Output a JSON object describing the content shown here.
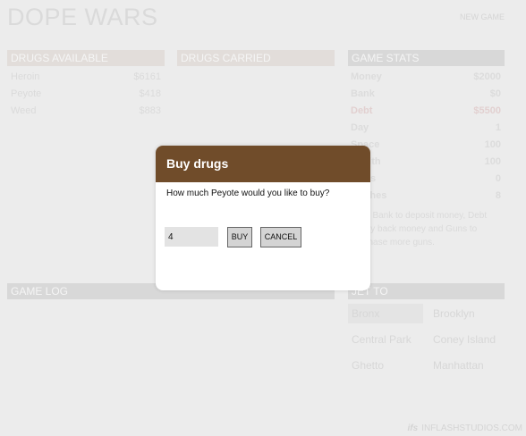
{
  "header": {
    "title": "DOPE WARS",
    "new_game": "NEW GAME"
  },
  "drugs_available": {
    "title": "DRUGS AVAILABLE",
    "items": [
      {
        "name": "Heroin",
        "price": "$6161"
      },
      {
        "name": "Peyote",
        "price": "$418"
      },
      {
        "name": "Weed",
        "price": "$883"
      }
    ]
  },
  "drugs_carried": {
    "title": "DRUGS CARRIED"
  },
  "game_stats": {
    "title": "GAME STATS",
    "items": [
      {
        "label": "Money",
        "value": "$2000"
      },
      {
        "label": "Bank",
        "value": "$0"
      },
      {
        "label": "Debt",
        "value": "$5500"
      },
      {
        "label": "Day",
        "value": "1"
      },
      {
        "label": "Space",
        "value": "100"
      },
      {
        "label": "Health",
        "value": "100"
      },
      {
        "label": "Guns",
        "value": "0"
      },
      {
        "label": "Clothes",
        "value": "8"
      }
    ],
    "note": "Click Bank to deposit money, Debt to pay back money and Guns to purchase more guns."
  },
  "game_log": {
    "title": "GAME LOG"
  },
  "jet_to": {
    "title": "JET TO",
    "cities": [
      "Bronx",
      "Brooklyn",
      "Central Park",
      "Coney Island",
      "Ghetto",
      "Manhattan"
    ],
    "current": "Bronx"
  },
  "dialog": {
    "title": "Buy drugs",
    "message": "How much Peyote would you like to buy?",
    "quantity": "4",
    "buy_label": "BUY",
    "cancel_label": "CANCEL"
  },
  "footer": {
    "logo": "ifs",
    "text": "INFLASHSTUDIOS.COM"
  },
  "colors": {
    "dialog_header": "#704c2a",
    "debt": "#d8b4b4",
    "background": "#ededed"
  }
}
